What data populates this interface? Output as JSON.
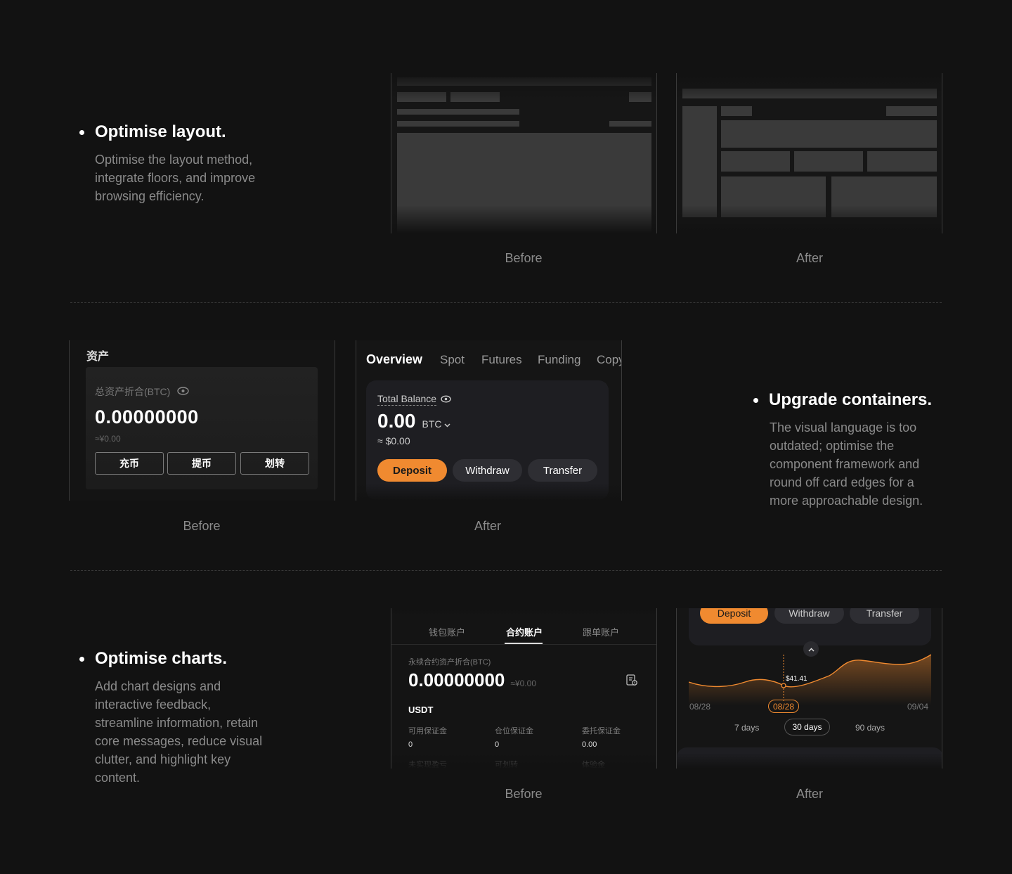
{
  "sections": [
    {
      "title": "Optimise layout.",
      "desc": [
        "Optimise the layout method,",
        "integrate floors, and improve",
        "browsing efficiency."
      ],
      "before_label": "Before",
      "after_label": "After"
    },
    {
      "title": "Upgrade containers.",
      "desc": [
        "The visual language is too",
        "outdated; optimise the",
        "component framework and",
        "round off card edges for a",
        "more approachable design."
      ],
      "before_label": "Before",
      "after_label": "After"
    },
    {
      "title": "Optimise charts.",
      "desc": [
        "Add chart designs and",
        "interactive feedback,",
        "streamline information, retain",
        "core messages, reduce visual",
        "clutter, and highlight key",
        "content."
      ],
      "before_label": "Before",
      "after_label": "After"
    }
  ],
  "assets_before": {
    "heading": "资产",
    "label": "总资产折合(BTC)",
    "amount": "0.00000000",
    "cny": "≈¥0.00",
    "buttons": [
      "充币",
      "提币",
      "划转"
    ]
  },
  "assets_after": {
    "tabs": [
      "Overview",
      "Spot",
      "Futures",
      "Funding",
      "Copy"
    ],
    "balance_label": "Total Balance",
    "amount": "0.00",
    "unit": "BTC",
    "usd": "≈ $0.00",
    "buttons": [
      "Deposit",
      "Withdraw",
      "Transfer"
    ]
  },
  "chart_before": {
    "tabs": [
      "钱包账户",
      "合约账户",
      "跟单账户"
    ],
    "label": "永续合约资产折合(BTC)",
    "amount": "0.00000000",
    "cny": "≈¥0.00",
    "currency": "USDT",
    "fields": [
      {
        "label": "可用保证金",
        "value": "0"
      },
      {
        "label": "仓位保证金",
        "value": "0"
      },
      {
        "label": "委托保证金",
        "value": "0.00"
      }
    ],
    "fields2": [
      "未实现盈亏",
      "可划转",
      "体验金"
    ]
  },
  "chart_after": {
    "buttons": [
      "Deposit",
      "Withdraw",
      "Transfer"
    ],
    "tooltip": "$41.41",
    "x_start": "08/28",
    "x_selected": "08/28",
    "x_end": "09/04",
    "ranges": [
      "7 days",
      "30 days",
      "90 days"
    ],
    "selected_range": "30 days"
  },
  "colors": {
    "accent": "#f08a30",
    "bg": "#121212",
    "card": "#1e1e22"
  }
}
